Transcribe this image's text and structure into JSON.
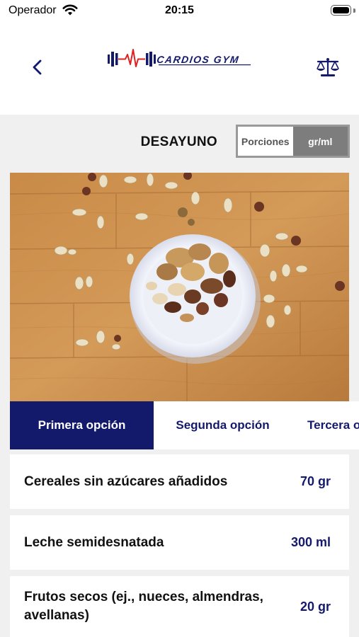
{
  "status": {
    "carrier": "Operador",
    "time": "20:15"
  },
  "header": {
    "logo_text": "CARDIOS GYM",
    "brand_color": "#13196b",
    "accent_color": "#e02020"
  },
  "meal": {
    "title": "DESAYUNO",
    "toggle": {
      "options": [
        "Porciones",
        "gr/ml"
      ],
      "selected": "gr/ml"
    }
  },
  "tabs": [
    {
      "label": "Primera opción",
      "active": true
    },
    {
      "label": "Segunda opción",
      "active": false
    },
    {
      "label": "Tercera opción",
      "active": false
    }
  ],
  "foods": [
    {
      "name": "Cereales sin azúcares añadidos",
      "amount": "70 gr"
    },
    {
      "name": "Leche semidesnatada",
      "amount": "300 ml"
    },
    {
      "name": "Frutos secos (ej., nueces, almendras, avellanas)",
      "amount": "20 gr"
    }
  ]
}
